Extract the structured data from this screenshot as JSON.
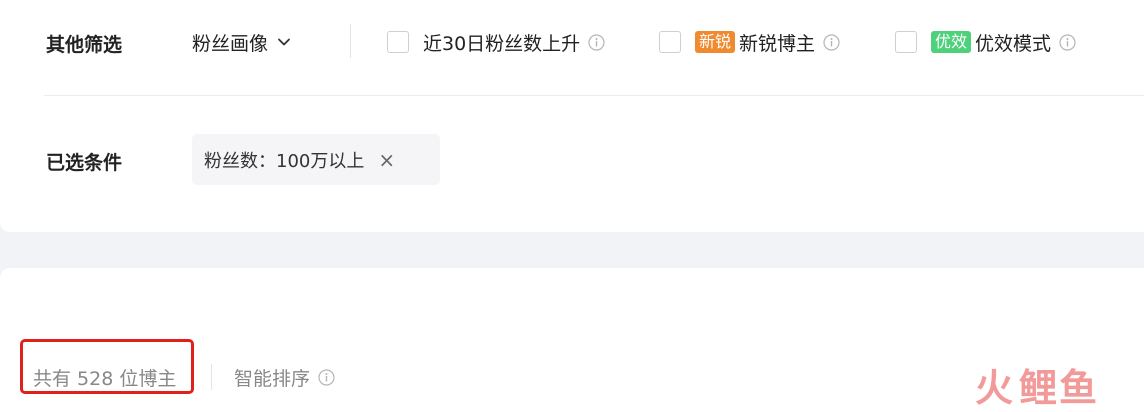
{
  "filters": {
    "other_label": "其他筛选",
    "dropdown_label": "粉丝画像",
    "options": [
      {
        "badge": "",
        "label": "近30日粉丝数上升"
      },
      {
        "badge": "新锐",
        "label": "新锐博主"
      },
      {
        "badge": "优效",
        "label": "优效模式"
      }
    ]
  },
  "selected": {
    "label": "已选条件",
    "tag_text": "粉丝数：100万以上",
    "remove_symbol": "×"
  },
  "results": {
    "count_text": "共有 528 位博主",
    "sort_label": "智能排序"
  },
  "watermark": {
    "left": "火",
    "right": "鲤鱼"
  },
  "colors": {
    "badge_orange": "#f08a2e",
    "badge_green": "#4fd07a",
    "highlight_red": "#e0201a"
  }
}
